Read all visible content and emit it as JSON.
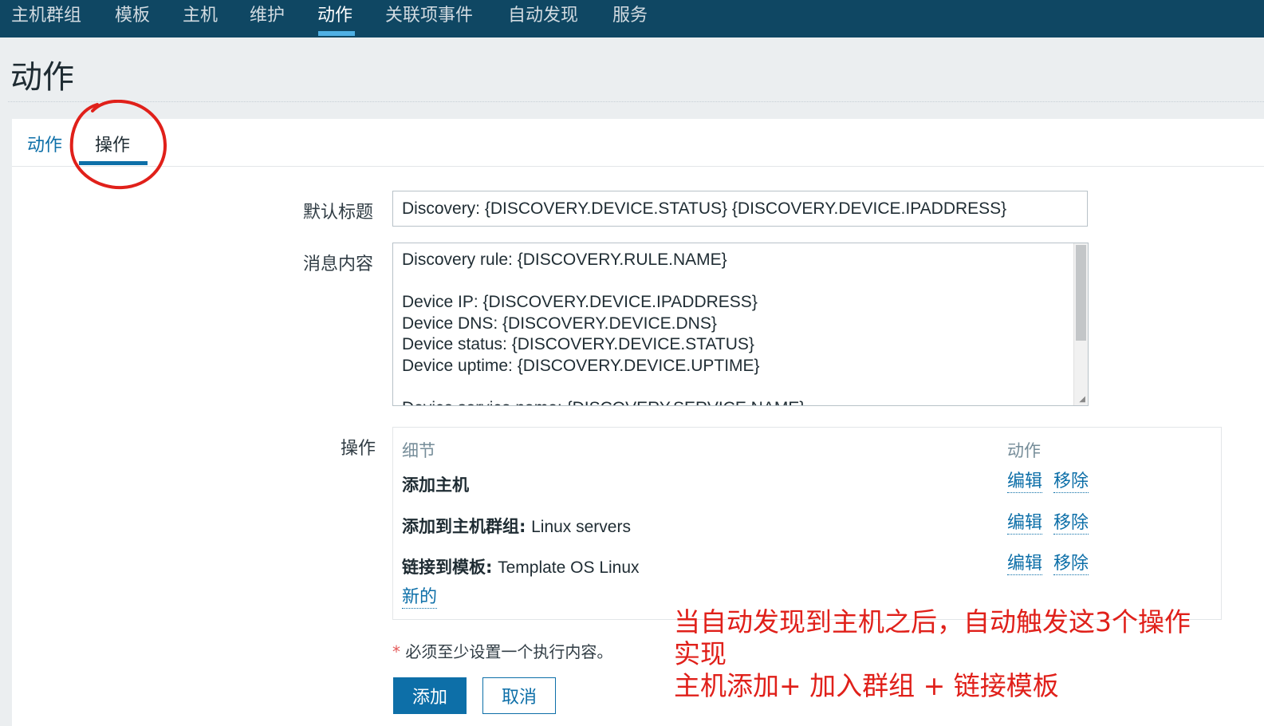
{
  "topnav": {
    "items": [
      "主机群组",
      "模板",
      "主机",
      "维护",
      "动作",
      "关联项事件",
      "自动发现",
      "服务"
    ],
    "active": "动作"
  },
  "page": {
    "title": "动作"
  },
  "tabs": [
    "动作",
    "操作"
  ],
  "form": {
    "subject_label": "默认标题",
    "subject_value": "Discovery: {DISCOVERY.DEVICE.STATUS} {DISCOVERY.DEVICE.IPADDRESS}",
    "message_label": "消息内容",
    "message_lines": [
      "Discovery rule: {DISCOVERY.RULE.NAME}",
      "",
      "Device IP: {DISCOVERY.DEVICE.IPADDRESS}",
      "Device DNS: {DISCOVERY.DEVICE.DNS}",
      "Device status: {DISCOVERY.DEVICE.STATUS}",
      "Device uptime: {DISCOVERY.DEVICE.UPTIME}",
      "",
      "Device service name: {DISCOVERY.SERVICE.NAME}"
    ],
    "operations_label": "操作"
  },
  "operations": {
    "col_details": "细节",
    "col_action": "动作",
    "rows": [
      {
        "name": "添加主机",
        "value": "",
        "edit": "编辑",
        "remove": "移除"
      },
      {
        "name": "添加到主机群组:",
        "value": "Linux servers",
        "edit": "编辑",
        "remove": "移除"
      },
      {
        "name": "链接到模板:",
        "value": "Template OS Linux",
        "edit": "编辑",
        "remove": "移除"
      }
    ],
    "new_link": "新的"
  },
  "required_note": {
    "star": "*",
    "text": "必须至少设置一个执行内容。"
  },
  "buttons": {
    "add": "添加",
    "cancel": "取消"
  },
  "annotation": {
    "lines": [
      "当自动发现到主机之后，自动触发这3个操作",
      "实现",
      "主机添加+ 加入群组 + 链接模板"
    ]
  },
  "colors": {
    "nav_bg": "#0f4763",
    "accent": "#0d6fa8",
    "annotation": "#e0201a"
  }
}
